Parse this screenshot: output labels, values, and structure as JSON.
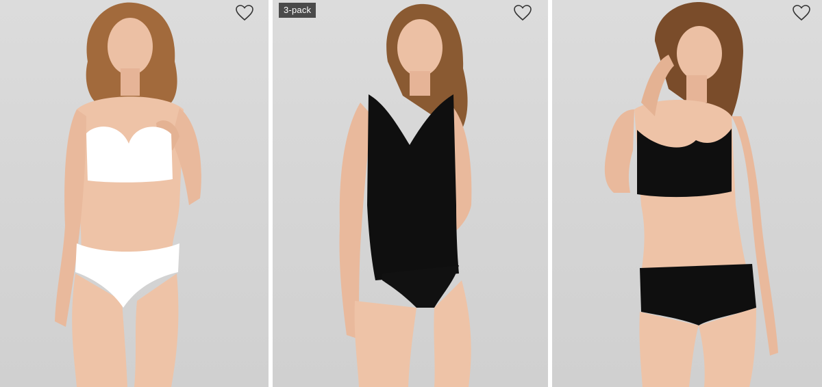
{
  "products": [
    {
      "image_desc": "model-in-white-bra-and-brief",
      "badge": "",
      "wishlist_icon": "heart-outline-icon"
    },
    {
      "image_desc": "model-in-black-tank-top-and-brief",
      "badge": "3-pack",
      "wishlist_icon": "heart-outline-icon"
    },
    {
      "image_desc": "model-in-black-bralette-and-hipster",
      "badge": "",
      "wishlist_icon": "heart-outline-icon"
    }
  ],
  "colors": {
    "background": "#d6d6d6",
    "badge_bg": "#4a4a4a",
    "badge_text": "#ffffff",
    "heart_stroke": "#333333"
  }
}
